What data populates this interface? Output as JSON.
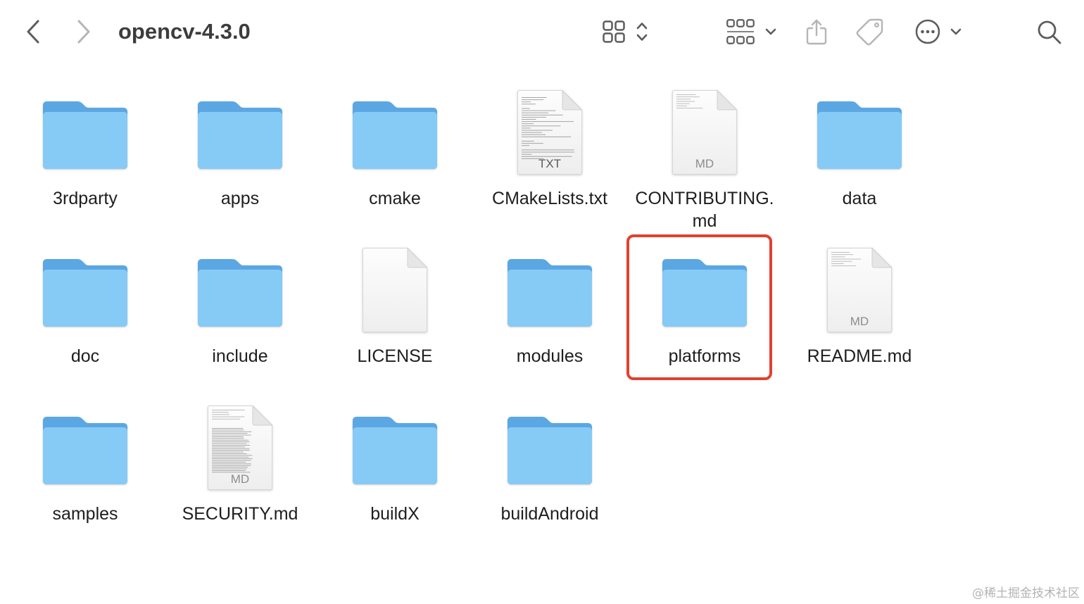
{
  "window": {
    "title": "opencv-4.3.0"
  },
  "toolbar": {
    "back": {
      "icon": "chevron-left-icon",
      "enabled": true
    },
    "forward": {
      "icon": "chevron-right-icon",
      "enabled": false
    },
    "view": {
      "icon": "icon-grid-view-icon",
      "chevron": "chevron-up-down-icon"
    },
    "group": {
      "icon": "group-by-icon",
      "chevron": "chevron-down-icon"
    },
    "share": {
      "icon": "share-icon"
    },
    "tag": {
      "icon": "tag-icon"
    },
    "more": {
      "icon": "ellipsis-circle-icon",
      "chevron": "chevron-down-icon"
    },
    "search": {
      "icon": "search-icon"
    }
  },
  "items": [
    {
      "name": "3rdparty",
      "icon": "folder-icon"
    },
    {
      "name": "apps",
      "icon": "folder-icon"
    },
    {
      "name": "cmake",
      "icon": "folder-icon"
    },
    {
      "name": "CMakeLists.txt",
      "icon": "text-document-icon",
      "badge": "TXT"
    },
    {
      "name": "CONTRIBUTING.md",
      "icon": "sparse-text-document-icon",
      "badge": "MD"
    },
    {
      "name": "data",
      "icon": "folder-icon"
    },
    {
      "name": "doc",
      "icon": "folder-icon"
    },
    {
      "name": "include",
      "icon": "folder-icon"
    },
    {
      "name": "LICENSE",
      "icon": "blank-document-icon"
    },
    {
      "name": "modules",
      "icon": "folder-icon"
    },
    {
      "name": "platforms",
      "icon": "folder-icon",
      "highlighted": true
    },
    {
      "name": "README.md",
      "icon": "sparse-text-document-icon",
      "badge": "MD"
    },
    {
      "name": "samples",
      "icon": "folder-icon"
    },
    {
      "name": "SECURITY.md",
      "icon": "dense-text-document-icon",
      "badge": "MD"
    },
    {
      "name": "buildX",
      "icon": "folder-icon"
    },
    {
      "name": "buildAndroid",
      "icon": "folder-icon"
    }
  ],
  "colors": {
    "folder_front": "#86caf6",
    "folder_back": "#5ba7e3",
    "highlight": "#e2412f",
    "icon_active": "#5c5c5c",
    "icon_disabled": "#b5b5b5",
    "label_text": "#1e1e1e"
  },
  "watermark": "@稀土掘金技术社区"
}
